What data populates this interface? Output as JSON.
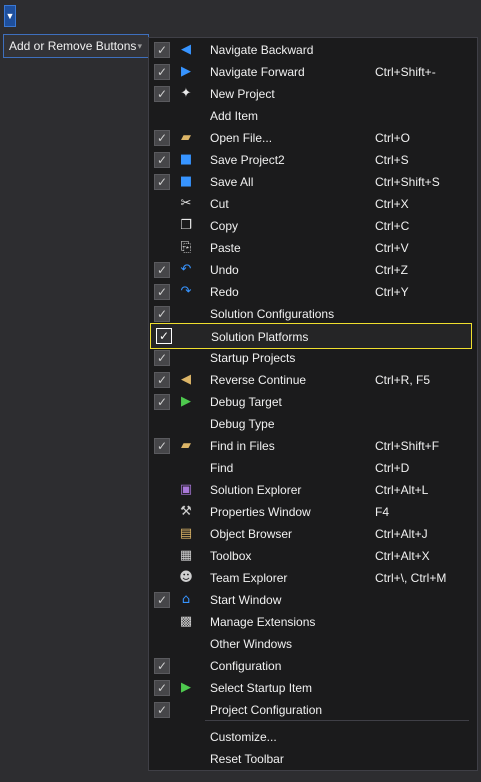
{
  "toolbar": {
    "overflow_glyph": "▼",
    "add_remove_label": "Add or Remove Buttons",
    "add_remove_chevron": "▾"
  },
  "colors": {
    "blue_icon": "#3794ff",
    "highlight_border": "#f0df2e",
    "green_play": "#4ec94e",
    "folder_yellow": "#dcb567"
  },
  "menu": {
    "items": [
      {
        "label": "Navigate Backward",
        "shortcut": "",
        "checked": true,
        "icon": "navigate-backward-icon",
        "glyph": "◀",
        "color": "#3794ff"
      },
      {
        "label": "Navigate Forward",
        "shortcut": "Ctrl+Shift+-",
        "checked": true,
        "icon": "navigate-forward-icon",
        "glyph": "▶",
        "color": "#3794ff"
      },
      {
        "label": "New Project",
        "shortcut": "",
        "checked": true,
        "icon": "new-project-icon",
        "glyph": "✦",
        "color": "#e8e8e8"
      },
      {
        "label": "Add Item",
        "shortcut": "",
        "checked": false,
        "icon": "",
        "glyph": "",
        "color": ""
      },
      {
        "label": "Open File...",
        "shortcut": "Ctrl+O",
        "checked": true,
        "icon": "open-file-icon",
        "glyph": "▰",
        "color": "#dcb567"
      },
      {
        "label": "Save Project2",
        "shortcut": "Ctrl+S",
        "checked": true,
        "icon": "save-icon",
        "glyph": "■",
        "color": "#3794ff"
      },
      {
        "label": "Save All",
        "shortcut": "Ctrl+Shift+S",
        "checked": true,
        "icon": "save-all-icon",
        "glyph": "■",
        "color": "#3794ff"
      },
      {
        "label": "Cut",
        "shortcut": "Ctrl+X",
        "checked": false,
        "icon": "cut-icon",
        "glyph": "✂",
        "color": "#e8e8e8"
      },
      {
        "label": "Copy",
        "shortcut": "Ctrl+C",
        "checked": false,
        "icon": "copy-icon",
        "glyph": "❐",
        "color": "#e8e8e8"
      },
      {
        "label": "Paste",
        "shortcut": "Ctrl+V",
        "checked": false,
        "icon": "paste-icon",
        "glyph": "⎘",
        "color": "#e8e8e8"
      },
      {
        "label": "Undo",
        "shortcut": "Ctrl+Z",
        "checked": true,
        "icon": "undo-icon",
        "glyph": "↶",
        "color": "#3794ff"
      },
      {
        "label": "Redo",
        "shortcut": "Ctrl+Y",
        "checked": true,
        "icon": "redo-icon",
        "glyph": "↷",
        "color": "#3794ff"
      },
      {
        "label": "Solution Configurations",
        "shortcut": "",
        "checked": true,
        "icon": "",
        "glyph": "",
        "color": ""
      },
      {
        "label": "Solution Platforms",
        "shortcut": "",
        "checked": true,
        "icon": "",
        "glyph": "",
        "color": "",
        "highlight": true
      },
      {
        "label": "Startup Projects",
        "shortcut": "",
        "checked": true,
        "icon": "",
        "glyph": "",
        "color": ""
      },
      {
        "label": "Reverse Continue",
        "shortcut": "Ctrl+R, F5",
        "checked": true,
        "icon": "reverse-continue-icon",
        "glyph": "◀",
        "color": "#dcb567"
      },
      {
        "label": "Debug Target",
        "shortcut": "",
        "checked": true,
        "icon": "debug-target-icon",
        "glyph": "▶",
        "color": "#4ec94e"
      },
      {
        "label": "Debug Type",
        "shortcut": "",
        "checked": false,
        "icon": "",
        "glyph": "",
        "color": ""
      },
      {
        "label": "Find in Files",
        "shortcut": "Ctrl+Shift+F",
        "checked": true,
        "icon": "find-in-files-icon",
        "glyph": "▰",
        "color": "#dcb567"
      },
      {
        "label": "Find",
        "shortcut": "Ctrl+D",
        "checked": false,
        "icon": "",
        "glyph": "",
        "color": ""
      },
      {
        "label": "Solution Explorer",
        "shortcut": "Ctrl+Alt+L",
        "checked": false,
        "icon": "solution-explorer-icon",
        "glyph": "▣",
        "color": "#a877d8"
      },
      {
        "label": "Properties Window",
        "shortcut": "F4",
        "checked": false,
        "icon": "properties-window-icon",
        "glyph": "⚒",
        "color": "#cfcfcf"
      },
      {
        "label": "Object Browser",
        "shortcut": "Ctrl+Alt+J",
        "checked": false,
        "icon": "object-browser-icon",
        "glyph": "▤",
        "color": "#dcb567"
      },
      {
        "label": "Toolbox",
        "shortcut": "Ctrl+Alt+X",
        "checked": false,
        "icon": "toolbox-icon",
        "glyph": "▦",
        "color": "#cfcfcf"
      },
      {
        "label": "Team Explorer",
        "shortcut": "Ctrl+\\, Ctrl+M",
        "checked": false,
        "icon": "team-explorer-icon",
        "glyph": "☻",
        "color": "#cfcfcf"
      },
      {
        "label": "Start Window",
        "shortcut": "",
        "checked": true,
        "icon": "start-window-icon",
        "glyph": "⌂",
        "color": "#3794ff"
      },
      {
        "label": "Manage Extensions",
        "shortcut": "",
        "checked": false,
        "icon": "manage-extensions-icon",
        "glyph": "▩",
        "color": "#cfcfcf"
      },
      {
        "label": "Other Windows",
        "shortcut": "",
        "checked": false,
        "icon": "",
        "glyph": "",
        "color": ""
      },
      {
        "label": "Configuration",
        "shortcut": "",
        "checked": true,
        "icon": "",
        "glyph": "",
        "color": ""
      },
      {
        "label": "Select Startup Item",
        "shortcut": "",
        "checked": true,
        "icon": "select-startup-item-icon",
        "glyph": "▶",
        "color": "#4ec94e"
      },
      {
        "label": "Project Configuration",
        "shortcut": "",
        "checked": true,
        "icon": "",
        "glyph": "",
        "color": ""
      }
    ],
    "footer_items": [
      {
        "label": "Customize..."
      },
      {
        "label": "Reset Toolbar"
      }
    ]
  }
}
